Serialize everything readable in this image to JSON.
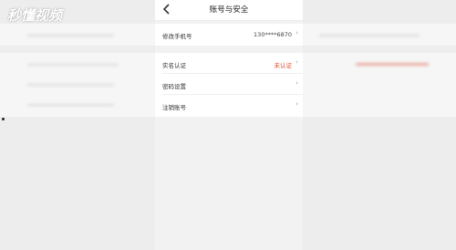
{
  "watermark": {
    "text": "秒懂视频"
  },
  "header": {
    "back_icon": "chevron-left-icon",
    "title": "账号与安全"
  },
  "groups": [
    {
      "rows": [
        {
          "label": "修改手机号",
          "value": "130****6870",
          "value_color": "#444444"
        }
      ]
    },
    {
      "rows": [
        {
          "label": "实名认证",
          "value": "未认证",
          "value_color": "#e04a2f"
        },
        {
          "label": "密码设置",
          "value": ""
        },
        {
          "label": "注销账号",
          "value": ""
        }
      ]
    }
  ],
  "colors": {
    "accent_red": "#e04a2f",
    "page_bg": "#f2f2f2"
  }
}
